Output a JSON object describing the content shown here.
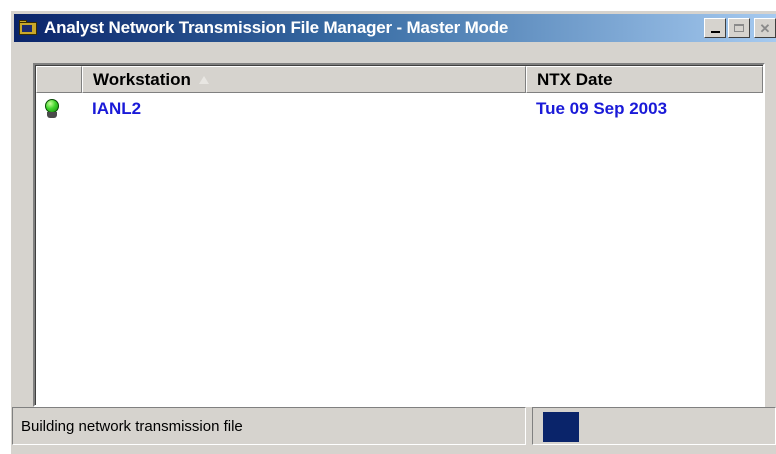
{
  "window": {
    "title": "Analyst Network Transmission File Manager - Master Mode",
    "app_icon": "folder-network-icon",
    "controls": [
      "minimize-icon",
      "maximize-icon",
      "close-icon"
    ]
  },
  "list": {
    "columns": [
      "",
      "Workstation",
      "NTX Date"
    ],
    "sort_column": "Workstation",
    "sort_direction": "ascending",
    "rows": [
      {
        "status_icon": "green-bulb-icon",
        "workstation": "IANL2",
        "ntx_date": "Tue 09 Sep 2003"
      }
    ]
  },
  "statusbar": {
    "message": "Building network transmission file",
    "progress_fraction": 0.15
  },
  "colors": {
    "title_gradient_start": "#0a246a",
    "title_gradient_end": "#a6caf0",
    "row_text": "#1a1ad8",
    "progress_fill": "#0a246a",
    "face": "#d6d3ce"
  }
}
